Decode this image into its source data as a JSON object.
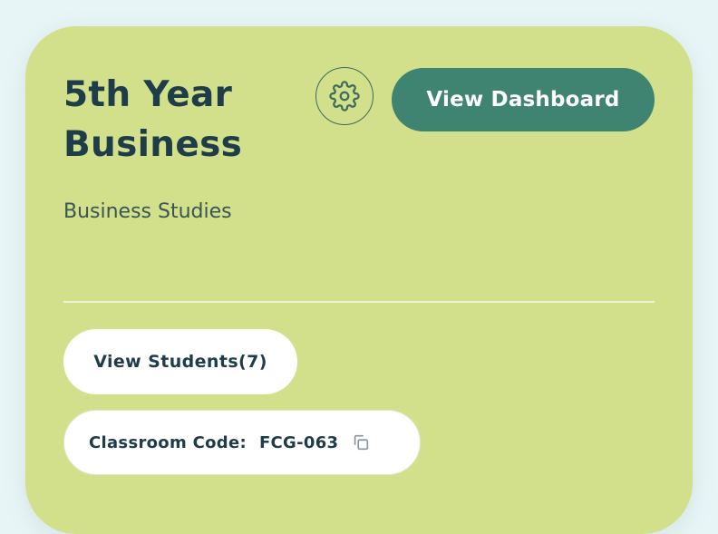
{
  "card": {
    "title": "5th Year Business",
    "subtitle": "Business Studies",
    "settings_icon": "gear-icon",
    "dashboard_button_label": "View Dashboard",
    "students_button_label": "View Students(7)",
    "classroom_code_label": "Classroom Code:",
    "classroom_code_value": "FCG-063",
    "copy_icon": "copy-icon"
  },
  "colors": {
    "background": "#e8f5f7",
    "card": "#d2e08b",
    "accent": "#3f8371",
    "text_dark": "#1f3d49",
    "pill": "#ffffff"
  }
}
